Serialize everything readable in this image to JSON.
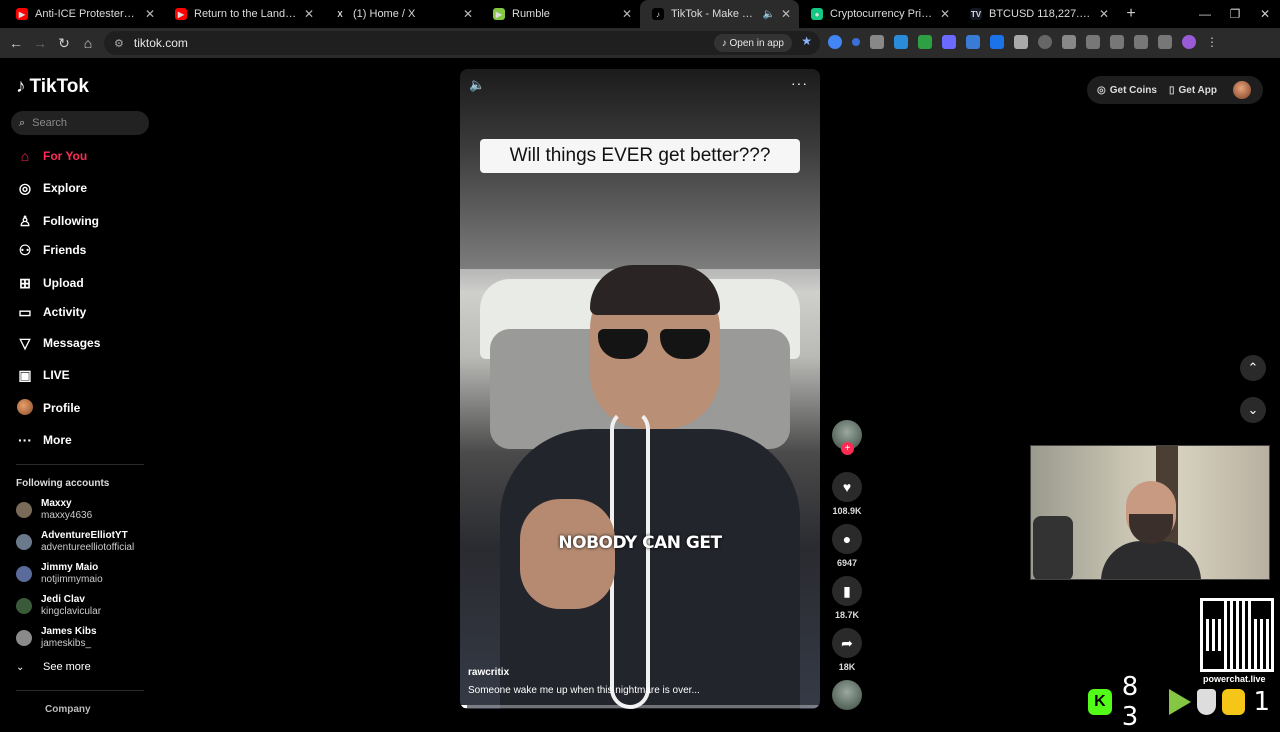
{
  "browser": {
    "tabs": [
      {
        "title": "Anti-ICE Protesters Can't Handl",
        "favicon_color": "#ff0000",
        "favicon": "▶",
        "active": false
      },
      {
        "title": "Return to the Land founder Eric",
        "favicon_color": "#ff0000",
        "favicon": "▶",
        "active": false
      },
      {
        "title": "(1) Home / X",
        "favicon_color": "#000000",
        "favicon": "X",
        "active": false
      },
      {
        "title": "Rumble",
        "favicon_color": "#85c742",
        "favicon": "▶",
        "active": false
      },
      {
        "title": "TikTok - Make Your Day",
        "favicon_color": "#000000",
        "favicon": "♪",
        "active": true
      },
      {
        "title": "Cryptocurrency Prices, Charts, a",
        "favicon_color": "#16c784",
        "favicon": "●",
        "active": false
      },
      {
        "title": "BTCUSD 118,227.57 ▲ +0.21%",
        "favicon_color": "#131722",
        "favicon": "TV",
        "active": false
      }
    ],
    "url": "tiktok.com",
    "open_in_app": "Open in app"
  },
  "sidebar": {
    "logo": "TikTok",
    "search_placeholder": "Search",
    "nav": [
      {
        "label": "For You",
        "icon": "home-icon",
        "active": true
      },
      {
        "label": "Explore",
        "icon": "compass-icon",
        "active": false
      },
      {
        "label": "Following",
        "icon": "user-follow-icon",
        "active": false
      },
      {
        "label": "Friends",
        "icon": "friends-icon",
        "active": false
      },
      {
        "label": "Upload",
        "icon": "upload-icon",
        "active": false
      },
      {
        "label": "Activity",
        "icon": "activity-icon",
        "active": false
      },
      {
        "label": "Messages",
        "icon": "messages-icon",
        "active": false
      },
      {
        "label": "LIVE",
        "icon": "live-icon",
        "active": false
      },
      {
        "label": "Profile",
        "icon": "profile-avatar",
        "active": false
      },
      {
        "label": "More",
        "icon": "more-icon",
        "active": false
      }
    ],
    "following_title": "Following accounts",
    "accounts": [
      {
        "name": "Maxxy",
        "handle": "maxxy4636"
      },
      {
        "name": "AdventureElliotYT",
        "handle": "adventureelliotofficial"
      },
      {
        "name": "Jimmy Maio",
        "handle": "notjimmymaio"
      },
      {
        "name": "Jedi Clav",
        "handle": "kingclavicular"
      },
      {
        "name": "James Kibs",
        "handle": "jameskibs_"
      }
    ],
    "see_more": "See more",
    "company": "Company"
  },
  "video": {
    "caption": "Will things EVER get better???",
    "subtitle": "NOBODY CAN GET",
    "author": "rawcritix",
    "description": "Someone wake me up when this nightmare is over...",
    "progress": 0.02
  },
  "actions": {
    "likes": "108.9K",
    "comments": "6947",
    "saves": "18.7K",
    "shares": "18K"
  },
  "header": {
    "get_coins": "Get Coins",
    "get_app": "Get App"
  },
  "overlay": {
    "powerchat": "powerchat.live",
    "viewer_count_a": "8 3",
    "viewer_count_b": "1"
  }
}
